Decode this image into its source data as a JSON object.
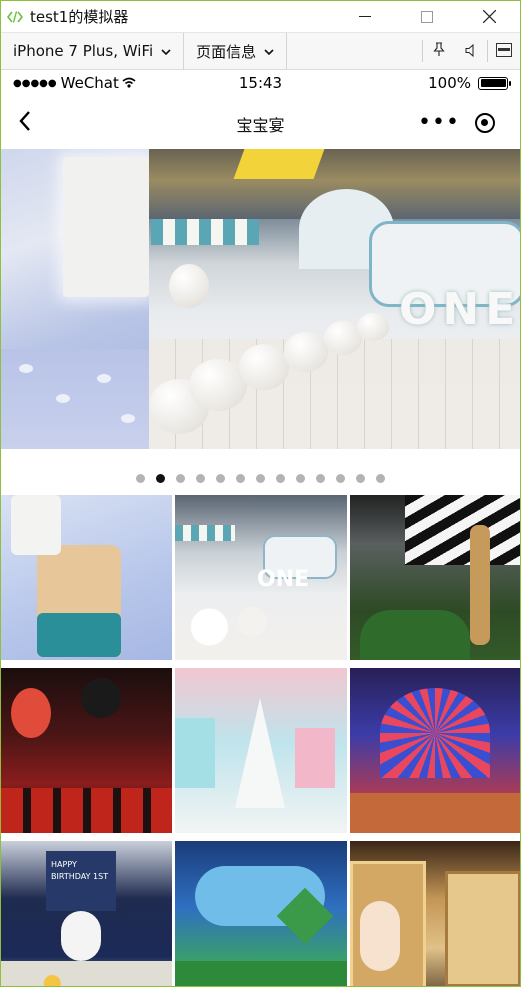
{
  "window": {
    "title": "test1的模拟器"
  },
  "device_toolbar": {
    "device_label": "iPhone 7 Plus, WiFi",
    "page_info_label": "页面信息"
  },
  "status_bar": {
    "dots": "●●●●●",
    "carrier": "WeChat",
    "time": "15:43",
    "battery_percent": "100%",
    "battery_level": 1.0
  },
  "nav": {
    "title": "宝宝宴",
    "more_glyph": "•••"
  },
  "swiper": {
    "slide_text": "ONE",
    "dot_count": 13,
    "active_index": 1
  },
  "gallery": {
    "items": [
      {
        "name": "photo-1"
      },
      {
        "name": "photo-2",
        "text": "ONE"
      },
      {
        "name": "photo-3"
      },
      {
        "name": "photo-4"
      },
      {
        "name": "photo-5"
      },
      {
        "name": "photo-6"
      },
      {
        "name": "photo-7",
        "text": "HAPPY BIRTHDAY 1ST"
      },
      {
        "name": "photo-8"
      },
      {
        "name": "photo-9"
      }
    ]
  }
}
